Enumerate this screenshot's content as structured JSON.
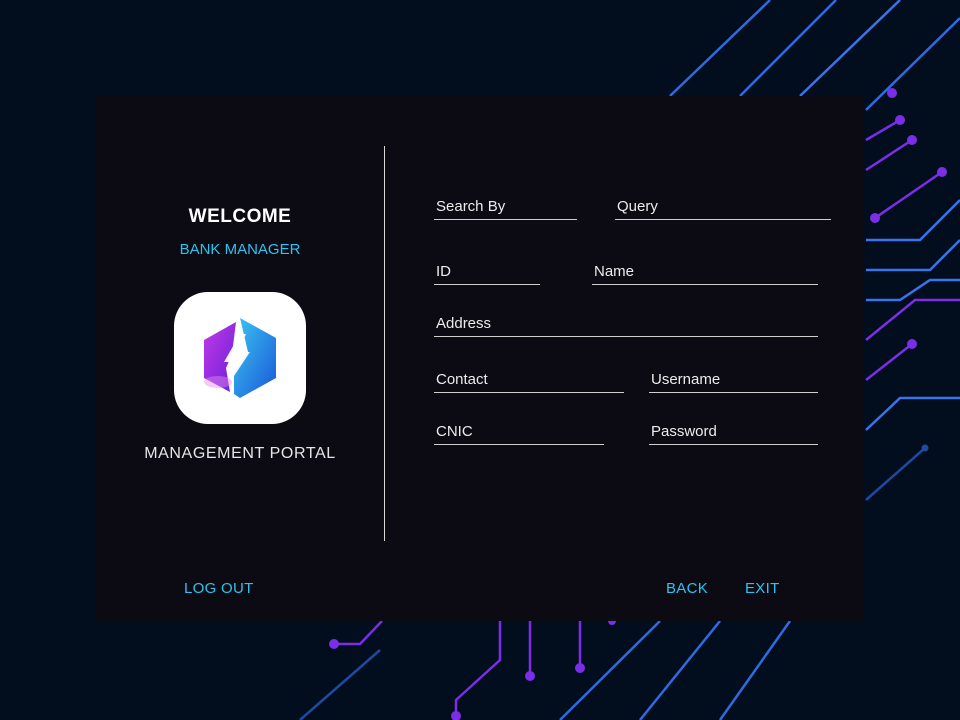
{
  "welcome": {
    "title": "WELCOME",
    "role": "BANK MANAGER",
    "portal": "MANAGEMENT PORTAL"
  },
  "form": {
    "search_by": {
      "placeholder": "Search By"
    },
    "query": {
      "placeholder": "Query"
    },
    "id": {
      "placeholder": "ID"
    },
    "name": {
      "placeholder": "Name"
    },
    "address": {
      "placeholder": "Address"
    },
    "contact": {
      "placeholder": "Contact"
    },
    "username": {
      "placeholder": "Username"
    },
    "cnic": {
      "placeholder": "CNIC"
    },
    "password": {
      "placeholder": "Password"
    }
  },
  "actions": {
    "logout": "LOG OUT",
    "back": "BACK",
    "exit": "EXIT"
  },
  "colors": {
    "background": "#020d1d",
    "panel": "#0d0b14",
    "accent": "#2ec3ee",
    "circuit_blue": "#2f6be0",
    "circuit_purple": "#7a2ee8"
  },
  "icons": {
    "logo": "bolt-hexagon-app-icon"
  }
}
